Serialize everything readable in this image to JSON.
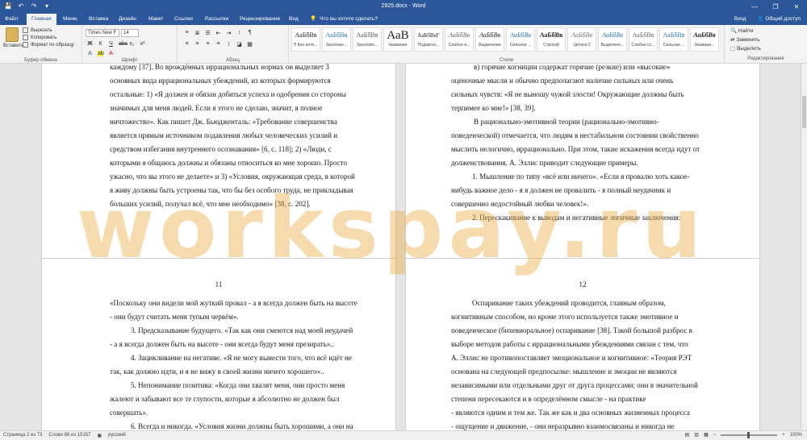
{
  "titlebar": {
    "title": "2925.docx - Word",
    "qat": [
      "💾",
      "↶",
      "↷",
      "▾"
    ],
    "minimize": "—",
    "restore": "❐",
    "close": "✕"
  },
  "tabs": {
    "items": [
      "Файл",
      "Главная",
      "Меню",
      "Вставка",
      "Дизайн",
      "Макет",
      "Ссылки",
      "Рассылки",
      "Рецензирование",
      "Вид"
    ],
    "tell_me": "Что вы хотите сделать?",
    "signin": "Вход",
    "share": "Общий доступ"
  },
  "ribbon": {
    "clipboard": {
      "paste": "Вставить",
      "cut": "Вырезать",
      "copy": "Копировать",
      "format_painter": "Формат по образцу",
      "label": "Буфер обмена"
    },
    "font": {
      "name": "Times New F",
      "size": "14",
      "label": "Шрифт",
      "buttons": [
        "Ж",
        "К",
        "Ч",
        "abc",
        "x₂",
        "x²",
        "A",
        "ab",
        "A"
      ]
    },
    "paragraph": {
      "label": "Абзац"
    },
    "styles": {
      "label": "Стили",
      "items": [
        {
          "sample": "АаБбВв",
          "name": "¶ Без инте..."
        },
        {
          "sample": "АаБбВв",
          "name": "Заголово..."
        },
        {
          "sample": "АаБбВв",
          "name": "Заголово..."
        },
        {
          "sample": "АаВ",
          "name": "Название"
        },
        {
          "sample": "АаБбВеГ",
          "name": "Подзагол..."
        },
        {
          "sample": "АаБбВв",
          "name": "Слабое в..."
        },
        {
          "sample": "АаБбВв",
          "name": "Выделение"
        },
        {
          "sample": "АаБбВв",
          "name": "Сильное ..."
        },
        {
          "sample": "АаБбВв",
          "name": "Строгий"
        },
        {
          "sample": "АаБбВв",
          "name": "Цитата 2"
        },
        {
          "sample": "АаБбВв",
          "name": "Выделенн..."
        },
        {
          "sample": "АаБбВв",
          "name": "Слабая сс..."
        },
        {
          "sample": "АаБбВв",
          "name": "Сильная ..."
        },
        {
          "sample": "АаБбВв",
          "name": "Названи..."
        }
      ]
    },
    "editing": {
      "find": "Найти",
      "replace": "Заменить",
      "select": "Выделить",
      "label": "Редактирование"
    }
  },
  "pages": {
    "top_left": [
      "каждому [37]. Во врождённых иррациональных нормах он выделяет 3",
      "основных вида иррациональных убеждений, из которых формируются",
      "остальные: 1) «Я должен и обязан добиться успеха и одобрения со стороны",
      "значимых для меня людей. Если я этого не сделаю, значит, я полное",
      "ничтожество». Как пишет Дж. Бьюдженталь: «Требование совершенства",
      "является прямым источником подавления любых человеческих усилий и",
      "средством избегания внутреннего осознавания» [6, с. 118]; 2) «Люди, с",
      "которыми я общаюсь должны и обязаны относиться ко мне хорошо. Просто",
      "ужасно, что вы этого не делаете» и 3) «Условия, окружающая среда, в которой",
      "я живу должны быть устроены так, что бы без особого труда, не прикладывая",
      "больших усилий, получал всё, что мне необходимо» [38, с. 202]."
    ],
    "top_right": [
      "в) горячие когниции содержат горячие (резкие) или «высокие»",
      "оценочные мысли и обычно предполагают наличие сильных или очень",
      "сильных чувств: «Я не выношу чужой злости! Окружающие должны быть",
      "терпимее ко мне!» [38, 39].",
      "В          рационально-эмотивной          теории          (рационально-эмотивно-",
      "поведенческой) отмечается, что людям в нестабильном состоянии свойственно",
      "мыслить нелогично, иррационально. При этом, такие искажения всегда идут от",
      "долженствования. А. Эллис приводит следующие примеры.",
      "1.   Мышление по типу «всё или ничего». «Если я провалю хоть какое-",
      "нибудь важное дело - я я должен не провалить - я полный неудачник и",
      "совершенно недостойный любви человек!».",
      "2.   Перескакивание к выводам и негативные логичные заключения:"
    ],
    "bottom_left": {
      "number": "11",
      "lines": [
        "«Поскольку они видели мой жуткий провал - а я всегда должен быть на высоте",
        "- они будут считать меня тупым червём».",
        "3.   Предсказывание будущего. «Так как они смеются над моей неудачей",
        "- а я всегда должен быть на высоте - они всегда будут меня презирать»..",
        "4.   Зацикливание на негативе. «Я не могу вынести того, что всё идёт не",
        "так, как должно идти, и я не вижу в своей жизни ничего хорошего»..",
        "5.   Непонимание позитива: «Когда они хвалят меня, они просто меня",
        "жалеют и забывают все те глупости, которые я абсолютно не должен был",
        "совершать».",
        "6.   Всегда и никогда. «Условия жизни должны быть хорошими, а они на"
      ]
    },
    "bottom_right": {
      "number": "12",
      "lines": [
        "Оспаривание    таких    убеждений    проводится,    главным    образом,",
        "когнитивным способом, но кроме этого используется также эмотивное и",
        "поведенческое (бихевиоральное) оспаривание [38]. Такой большой разброс в",
        "выборе методов работы с иррациональными убеждениями связан с тем, что",
        "А. Эллис не противопоставляет эмоциональное и когнитивное: «Теория РЭТ",
        "основана на следующей предпосылке: мышление и эмоции не являются",
        "независимыми или отдельными друг от друга процессами; они в значительной",
        "степени пересекаются и в определённом смысле - на практике",
        "-  являются одним и тем же. Так же как и два основных жизненных процесса",
        "-  ощущение и движение, - они неразрывно взаимосвязаны и никогда не"
      ]
    }
  },
  "watermark": "workspay.ru",
  "statusbar": {
    "page": "Страница 2 из 73",
    "words": "Слово 86 из 15157",
    "lang": "русский",
    "zoom": "100%"
  }
}
